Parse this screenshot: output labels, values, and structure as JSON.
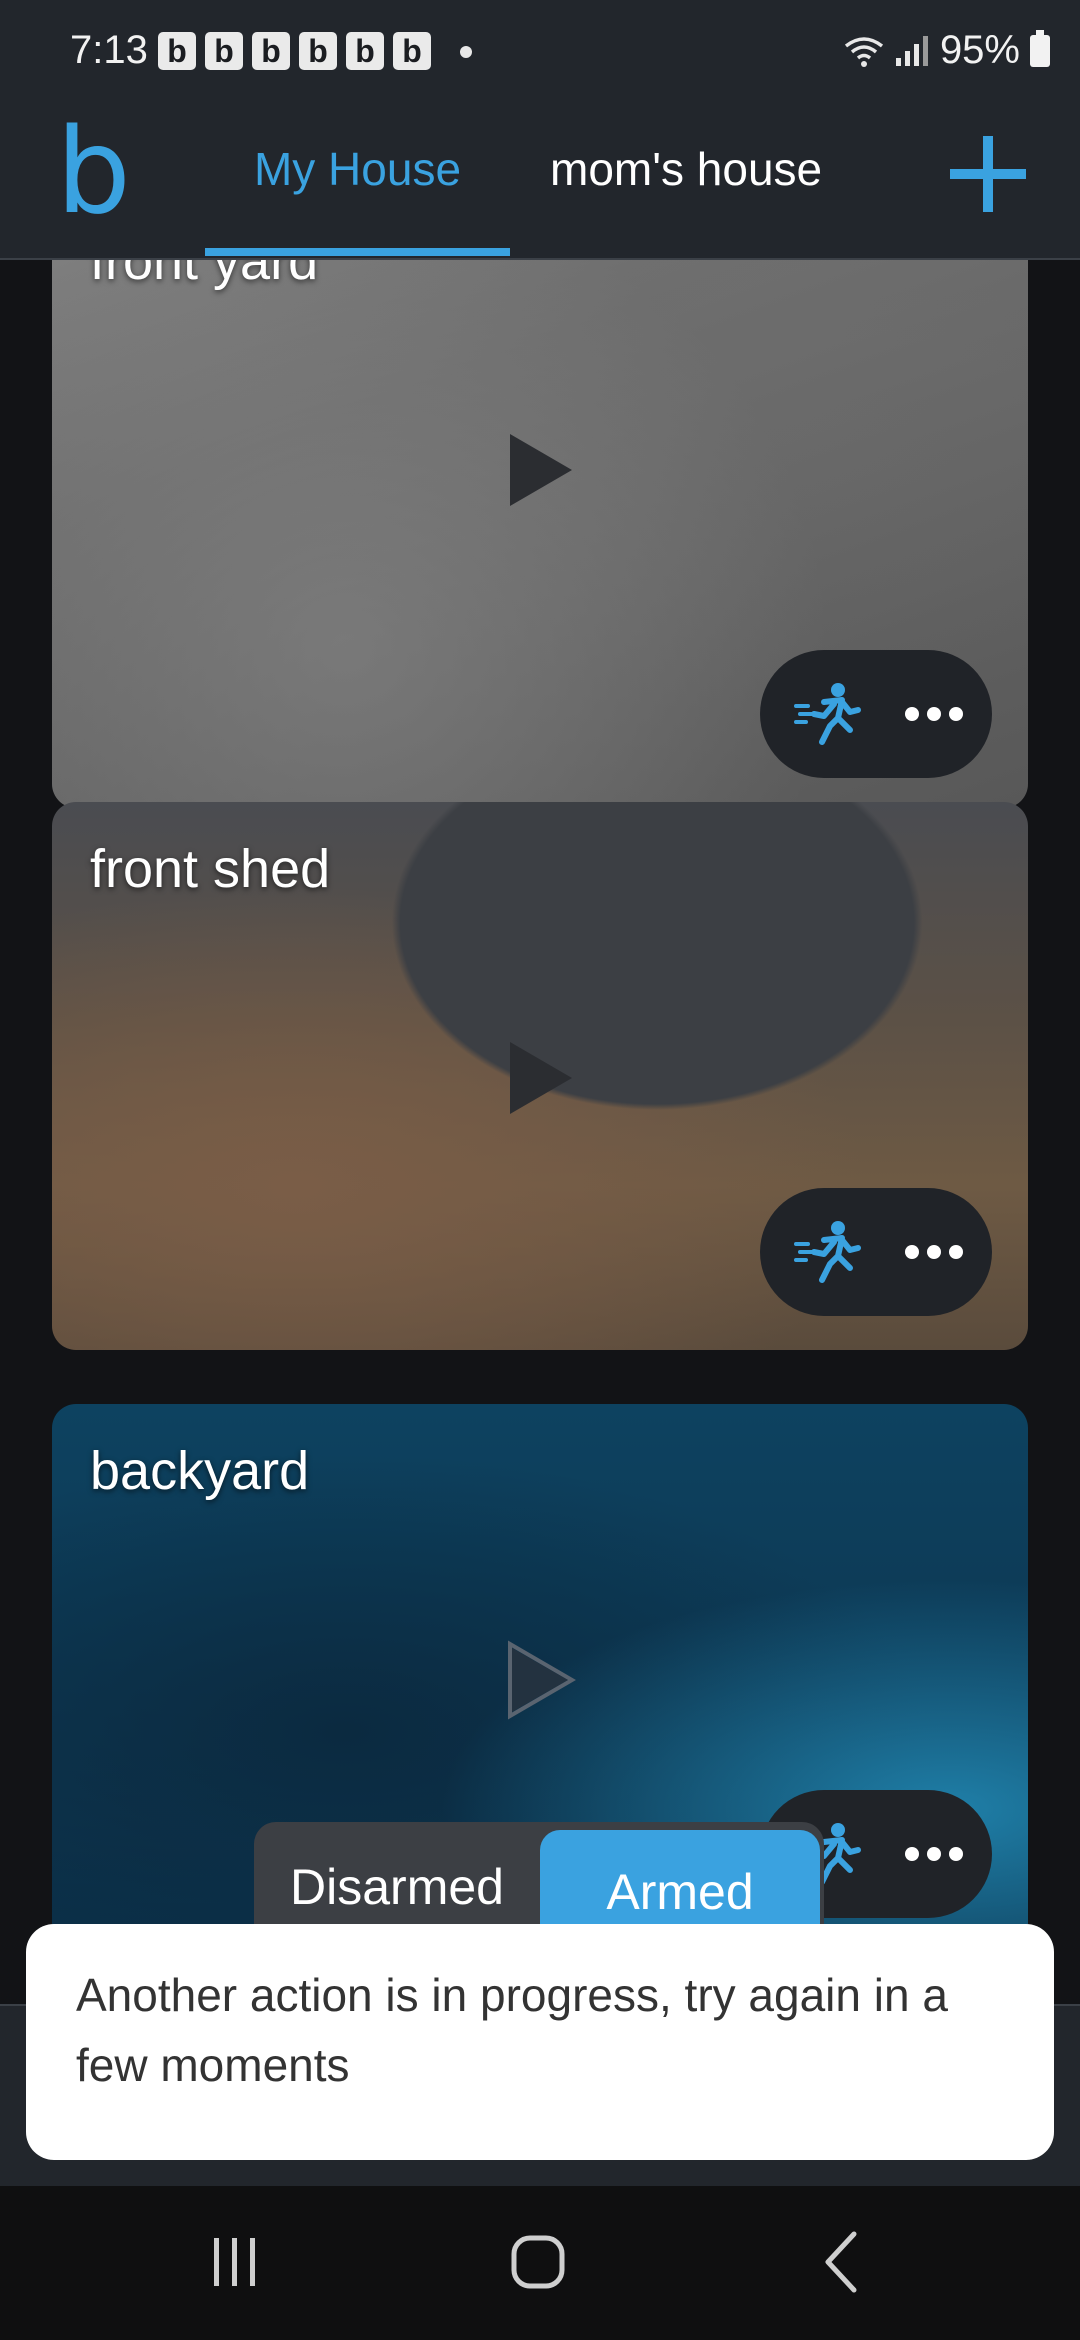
{
  "status_bar": {
    "time": "7:13",
    "notif_letters": [
      "b",
      "b",
      "b",
      "b",
      "b",
      "b"
    ],
    "battery": "95%"
  },
  "header": {
    "logo": "b",
    "tabs": [
      {
        "label": "My House",
        "active": true
      },
      {
        "label": "mom's house",
        "active": false
      }
    ],
    "accent": "#3aa2e0"
  },
  "cameras": [
    {
      "name": "front yard"
    },
    {
      "name": "front shed"
    },
    {
      "name": "backyard"
    }
  ],
  "arm_toggle": {
    "off_label": "Disarmed",
    "on_label": "Armed",
    "selected": "Armed"
  },
  "toast": {
    "message": "Another action is in progress, try again in a few moments"
  }
}
